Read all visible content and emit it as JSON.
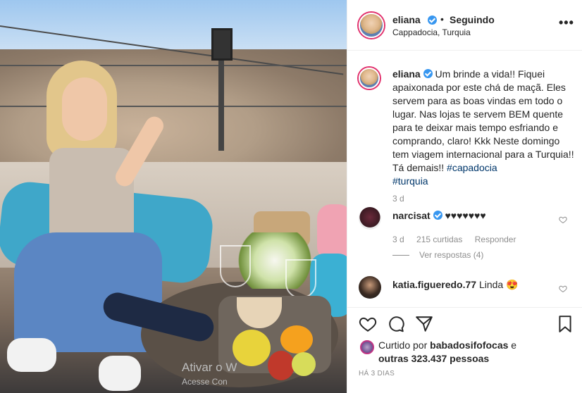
{
  "post": {
    "username": "eliana",
    "follow_status": "Seguindo",
    "location": "Cappadocia, Turquia",
    "more_label": "•••"
  },
  "caption": {
    "username": "eliana",
    "text": " Um brinde a vida!! Fiquei apaixonada por este chá de maçã. Eles servem para as boas vindas em todo o lugar. Nas lojas te servem BEM quente para te deixar mais tempo esfriando e comprando, claro! Kkk Neste domingo tem viagem internacional para a Turquia!! Tá demais!! ",
    "tags": [
      "#capadocia",
      "#turquia"
    ],
    "time": "3 d"
  },
  "comments": [
    {
      "username": "narcisat",
      "text": "♥♥♥♥♥♥♥",
      "time": "3 d",
      "likes": "215 curtidas",
      "reply_label": "Responder",
      "view_replies": "Ver respostas (4)"
    },
    {
      "username": "katia.figueredo.77",
      "text": "Linda 😍"
    }
  ],
  "likes": {
    "prefix": "Curtido por ",
    "user": "babadosifofocas",
    "middle": " e",
    "others": "outras 323.437 pessoas"
  },
  "posted_ago": "HÁ 3 DIAS",
  "watermark": {
    "line1": "Ativar o W",
    "line2": "Acesse Con"
  },
  "colors": {
    "verified": "#3897f0",
    "story_ring": "#e1306c",
    "hashtag": "#00376b",
    "muted": "#8e8e8e"
  }
}
